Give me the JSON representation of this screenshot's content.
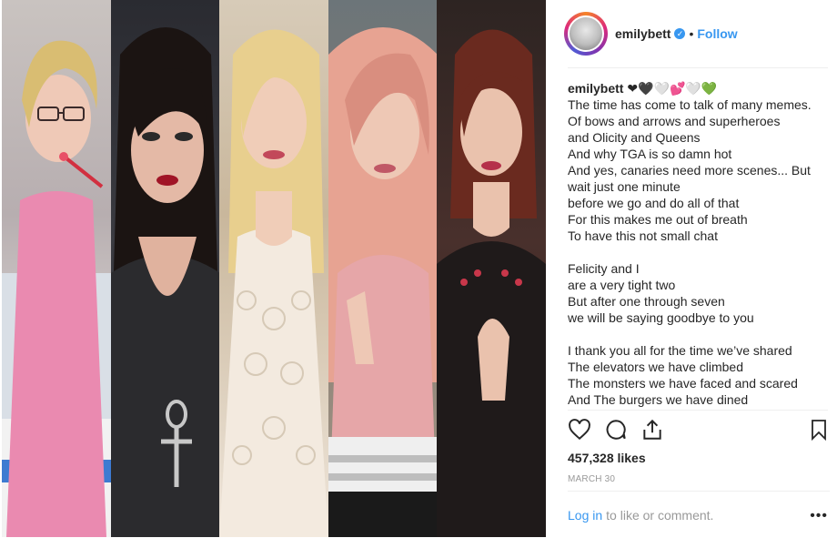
{
  "post": {
    "image_alt": "collage of five portraits",
    "username": "emilybett",
    "verified_icon": "verified-badge-icon",
    "separator": "•",
    "follow_label": "Follow"
  },
  "caption": {
    "username": "emilybett",
    "emoji": "❤🖤🤍💕🤍💚",
    "lines": [
      "The time has come to talk of many memes.",
      "Of bows and arrows and superheroes",
      "and Olicity and Queens",
      "And why TGA is so damn hot",
      "And yes, canaries need more scenes... But wait just one minute",
      "before we go and do all of that",
      "For this makes me out of breath",
      "To have this not small chat",
      "",
      "Felicity and I",
      "are a very tight two",
      "But after one through seven",
      "we will be saying goodbye to you",
      "",
      "I thank you all for the time we’ve shared",
      "The elevators we have climbed",
      "The monsters we have faced and scared",
      "And The burgers we have dined"
    ]
  },
  "actions": {
    "like_icon": "heart-icon",
    "comment_icon": "comment-icon",
    "share_icon": "share-icon",
    "save_icon": "bookmark-icon",
    "likes": "457,328 likes",
    "date": "MARCH 30"
  },
  "comment_bar": {
    "login_label": "Log in",
    "prompt": "to like or comment.",
    "more_label": "•••"
  }
}
